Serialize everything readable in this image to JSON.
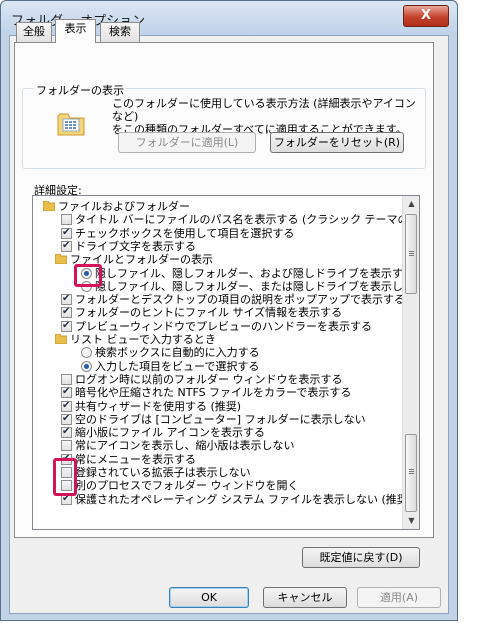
{
  "window": {
    "title": "フォルダー オプション",
    "close_glyph": "X"
  },
  "tabs": [
    {
      "label": "全般",
      "active": false
    },
    {
      "label": "表示",
      "active": true
    },
    {
      "label": "検索",
      "active": false
    }
  ],
  "folder_view": {
    "legend": "フォルダーの表示",
    "description_line1": "このフォルダーに使用している表示方法 (詳細表示やアイコンなど)",
    "description_line2": "をこの種類のフォルダーすべてに適用することができます。",
    "apply_button": "フォルダーに適用(L)",
    "reset_button": "フォルダーをリセット(R)"
  },
  "advanced": {
    "label": "詳細設定:",
    "items": [
      {
        "type": "folder",
        "label": "ファイルおよびフォルダー"
      },
      {
        "type": "checkbox",
        "checked": false,
        "label": "タイトル バーにファイルのパス名を表示する (クラシック テーマのみ)"
      },
      {
        "type": "checkbox",
        "checked": true,
        "label": "チェックボックスを使用して項目を選択する"
      },
      {
        "type": "checkbox",
        "checked": true,
        "label": "ドライブ文字を表示する"
      },
      {
        "type": "folder",
        "label": "ファイルとフォルダーの表示"
      },
      {
        "type": "radio",
        "checked": true,
        "label": "隠しファイル、隠しフォルダー、および隠しドライブを表示する"
      },
      {
        "type": "radio",
        "checked": false,
        "label": "隠しファイル、隠しフォルダー、または隠しドライブを表示しない"
      },
      {
        "type": "checkbox",
        "checked": true,
        "label": "フォルダーとデスクトップの項目の説明をポップアップで表示する"
      },
      {
        "type": "checkbox",
        "checked": true,
        "label": "フォルダーのヒントにファイル サイズ情報を表示する"
      },
      {
        "type": "checkbox",
        "checked": true,
        "label": "プレビューウィンドウでプレビューのハンドラーを表示する"
      },
      {
        "type": "folder",
        "label": "リスト ビューで入力するとき"
      },
      {
        "type": "radio",
        "checked": false,
        "label": "検索ボックスに自動的に入力する"
      },
      {
        "type": "radio",
        "checked": true,
        "label": "入力した項目をビューで選択する"
      },
      {
        "type": "checkbox",
        "checked": false,
        "label": "ログオン時に以前のフォルダー ウィンドウを表示する"
      },
      {
        "type": "checkbox",
        "checked": true,
        "label": "暗号化や圧縮された NTFS ファイルをカラーで表示する"
      },
      {
        "type": "checkbox",
        "checked": true,
        "label": "共有ウィザードを使用する (推奨)"
      },
      {
        "type": "checkbox",
        "checked": true,
        "label": "空のドライブは [コンピューター] フォルダーに表示しない"
      },
      {
        "type": "checkbox",
        "checked": true,
        "label": "縮小版にファイル アイコンを表示する"
      },
      {
        "type": "checkbox",
        "checked": false,
        "label": "常にアイコンを表示し、縮小版は表示しない"
      },
      {
        "type": "checkbox",
        "checked": true,
        "label": "常にメニューを表示する"
      },
      {
        "type": "checkbox",
        "checked": false,
        "label": "登録されている拡張子は表示しない"
      },
      {
        "type": "checkbox",
        "checked": false,
        "label": "別のプロセスでフォルダー ウィンドウを開く"
      },
      {
        "type": "checkbox",
        "checked": true,
        "label": "保護されたオペレーティング システム ファイルを表示しない (推奨)"
      }
    ]
  },
  "restore_button": "既定値に戻す(D)",
  "footer": {
    "ok": "OK",
    "cancel": "キャンセル",
    "apply": "適用(A)"
  },
  "colors": {
    "highlight": "#d4145a",
    "close_button": "#c4422c"
  }
}
